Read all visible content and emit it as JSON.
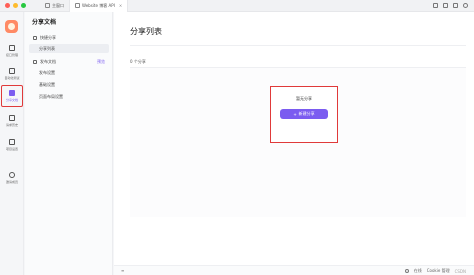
{
  "browser": {
    "tabs": [
      {
        "label": "主窗口",
        "icon": "home-icon"
      },
      {
        "label": "Website 博客 API",
        "icon": "globe-icon"
      }
    ]
  },
  "rail": {
    "items": [
      {
        "label": "接口管理",
        "icon": "api-icon"
      },
      {
        "label": "自动化测试",
        "icon": "test-icon"
      },
      {
        "label": "分享文档",
        "icon": "share-doc-icon"
      },
      {
        "label": "请求历史",
        "icon": "history-icon"
      },
      {
        "label": "项目设置",
        "icon": "settings-icon"
      },
      {
        "label": "邀请成员",
        "icon": "invite-icon"
      }
    ]
  },
  "panel": {
    "title": "分享文档",
    "items": [
      {
        "label": "快捷分享",
        "level": 0
      },
      {
        "label": "分享列表",
        "level": 1
      },
      {
        "label": "发布文档",
        "level": 0,
        "tag": "预览"
      },
      {
        "label": "发布设置",
        "level": 1
      },
      {
        "label": "基础设置",
        "level": 1
      },
      {
        "label": "页面布局设置",
        "level": 1
      }
    ]
  },
  "main": {
    "title": "分享列表",
    "count": "0 个分享",
    "empty_text": "暂无分享",
    "new_button": "新建分享"
  },
  "footer": {
    "left": "≡",
    "right_items": [
      "在线",
      "Cookie 管理",
      "CSDN"
    ]
  },
  "colors": {
    "accent": "#7b5cf0",
    "highlight": "#e03a3a"
  }
}
